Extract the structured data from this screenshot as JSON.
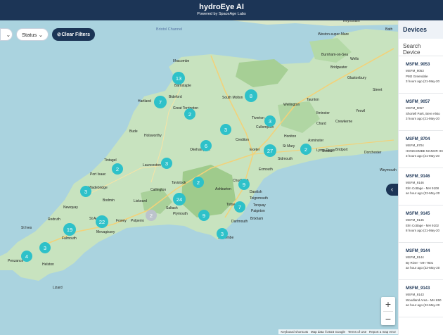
{
  "header": {
    "title": "hydroEye AI",
    "subtitle": "Powered by SpaceAge Labs"
  },
  "filters": {
    "status_label": "Status",
    "clear_label": "Clear Filters"
  },
  "devices_panel": {
    "title": "Devices",
    "search_placeholder": "Search Device",
    "devices": [
      {
        "name": "MSFM_9053",
        "id": "MSFM_9053",
        "location": "PM2 Greendale",
        "time": "3 hours ago (21-May-20"
      },
      {
        "name": "MSFM_9057",
        "id": "MSFM_9057",
        "location": "Shortell Park, Bere Alsto",
        "time": "3 hours ago (21-May-20"
      },
      {
        "name": "MSFM_8704",
        "id": "MSFM_8704",
        "location": "HONICOMBE MANOR HO",
        "time": "3 hours ago (21-May-20"
      },
      {
        "name": "MSFM_9146",
        "id": "MSFM_9146",
        "location": "Elm Cottage - MH 9108",
        "time": "an hour ago (22-May-20"
      },
      {
        "name": "MSFM_9145",
        "id": "MSFM_9145",
        "location": "Elm Cottage - MH 9102",
        "time": "8 hours ago (21-May-20"
      },
      {
        "name": "MSFM_9144",
        "id": "MSFM_9144",
        "location": "By River - MH 7601",
        "time": "an hour ago (22-May-20"
      },
      {
        "name": "MSFM_9143",
        "id": "MSFM_9143",
        "location": "Woodland Area - MH 650",
        "time": "an hour ago (22-May-20"
      }
    ]
  },
  "map": {
    "zoom_in": "+",
    "zoom_out": "−",
    "attribution": [
      "Keyboard shortcuts",
      "Map data ©2023 Google",
      "Terms of Use",
      "Report a map error"
    ],
    "sea_labels": [
      "Bristol Channel"
    ],
    "places": [
      "Keynsham",
      "Bath",
      "Weston-super-Mare",
      "Burnham-on-Sea",
      "Wells",
      "Bridgwater",
      "Ilfracombe",
      "Barnstaple",
      "South Molton",
      "Taunton",
      "Glastonbury",
      "Street",
      "Bideford",
      "Hartland",
      "Great Torrington",
      "Tiverton",
      "Wellington",
      "Ilminster",
      "Yeovil",
      "Crewkerne",
      "Chard",
      "Cullompton",
      "Honiton",
      "Axminster",
      "Bude",
      "Holsworthy",
      "Okehampton",
      "Crediton",
      "Exeter",
      "Bridport",
      "Dorchester",
      "Sidmouth",
      "Lyme Regis",
      "Tintagel",
      "Launceston",
      "Exmouth",
      "Weymouth",
      "Port Isaac",
      "Wadebridge",
      "Tavistock",
      "Ashburton",
      "Teignmouth",
      "Newquay",
      "Bodmin",
      "Callington",
      "Totnes",
      "Paignton",
      "Brixham",
      "Liskeard",
      "Saltash",
      "Plymouth",
      "Dartmouth",
      "Fowey",
      "Polperro",
      "St Austell",
      "Mevagissey",
      "Redruth",
      "St Ives",
      "Falmouth",
      "Penzance",
      "Helston",
      "Lizard",
      "Salcombe",
      "Chudleigh",
      "Dawlish",
      "Torquay",
      "St Mary",
      "Seaton"
    ],
    "clusters": [
      {
        "count": "13",
        "color": "#2ec1c9"
      },
      {
        "count": "8",
        "color": "#2ec1c9"
      },
      {
        "count": "7",
        "color": "#2ec1c9"
      },
      {
        "count": "2",
        "color": "#2ec1c9"
      },
      {
        "count": "3",
        "color": "#2ec1c9"
      },
      {
        "count": "3",
        "color": "#2ec1c9"
      },
      {
        "count": "6",
        "color": "#2ec1c9"
      },
      {
        "count": "27",
        "color": "#2ec1c9"
      },
      {
        "count": "2",
        "color": "#2ec1c9"
      },
      {
        "count": "3",
        "color": "#2ec1c9"
      },
      {
        "count": "2",
        "color": "#2ec1c9"
      },
      {
        "count": "2",
        "color": "#2ec1c9"
      },
      {
        "count": "3",
        "color": "#2ec1c9"
      },
      {
        "count": "9",
        "color": "#2ec1c9"
      },
      {
        "count": "24",
        "color": "#2ec1c9"
      },
      {
        "count": "2",
        "color": "#bcc3cc"
      },
      {
        "count": "7",
        "color": "#2ec1c9"
      },
      {
        "count": "9",
        "color": "#2ec1c9"
      },
      {
        "count": "22",
        "color": "#2ec1c9"
      },
      {
        "count": "19",
        "color": "#2ec1c9"
      },
      {
        "count": "3",
        "color": "#2ec1c9"
      },
      {
        "count": "3",
        "color": "#2ec1c9"
      },
      {
        "count": "4",
        "color": "#2ec1c9"
      }
    ]
  }
}
